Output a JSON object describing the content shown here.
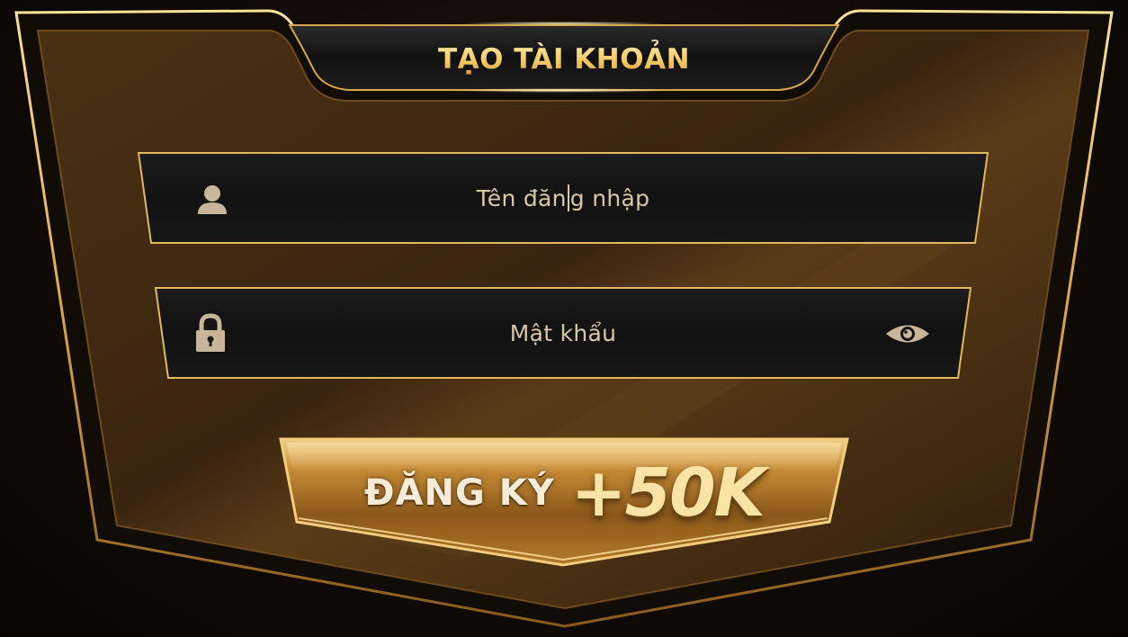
{
  "dialog": {
    "title": "TẠO TÀI KHOẢN"
  },
  "form": {
    "username": {
      "placeholder_before_caret": "Tên đăn",
      "placeholder_after_caret": "g nhập",
      "icon": "user-icon"
    },
    "password": {
      "placeholder": "Mật khẩu",
      "icon": "lock-icon",
      "toggle_icon": "eye-icon"
    }
  },
  "register_button": {
    "label": "ĐĂNG KÝ",
    "bonus": "+50K"
  },
  "colors": {
    "gold": "#f3c862",
    "gold_border": "#e2b85a",
    "panel": "#3b260f",
    "field_bg": "#161616",
    "text": "#d9c7a6"
  }
}
